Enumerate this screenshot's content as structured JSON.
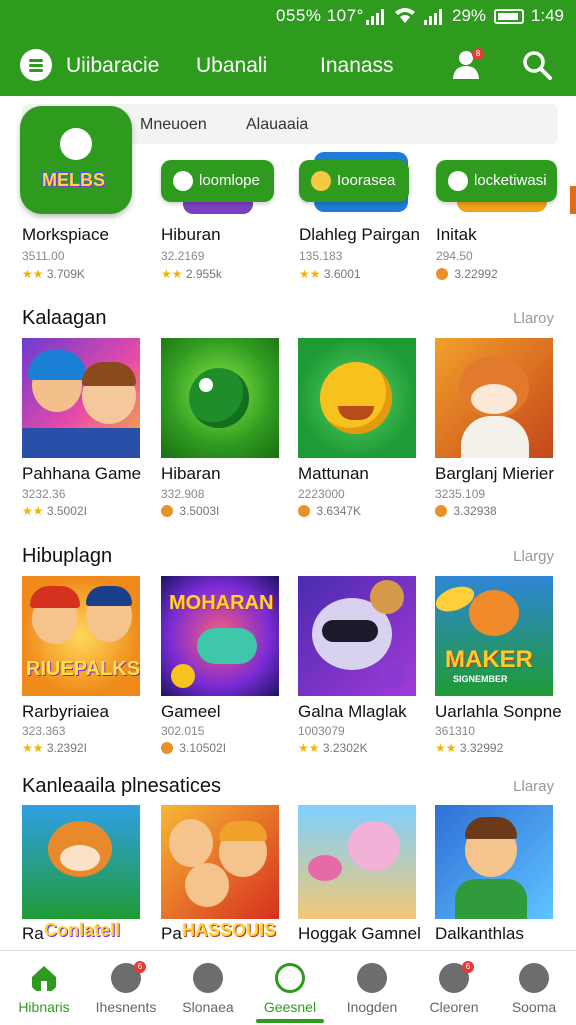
{
  "status_bar": {
    "left_text": "055% 107°",
    "battery_text": "29%",
    "time": "1:49"
  },
  "header": {
    "tabs": [
      "Uiibaracie",
      "Ubanali",
      "Inanass"
    ],
    "user_badge": "8",
    "colors": {
      "brand": "#2e9b1f",
      "header_bg": "#2e9b1f"
    }
  },
  "subtabs": [
    "Mneuoen",
    "Alauaaia"
  ],
  "featured": {
    "app_logo_text": "MELBS",
    "pills": [
      "loomlope",
      "Ioorasea",
      "locketiwasi"
    ],
    "cards": [
      {
        "title": "Morkspiace",
        "sub": "3511.00",
        "rating": "3.709K",
        "rating_icon": "star"
      },
      {
        "title": "Hiburan",
        "sub": "32.2169",
        "rating": "2.955k",
        "rating_icon": "star"
      },
      {
        "title": "Dlahleg Pairgan",
        "sub": "135.183",
        "rating": "3.6001",
        "rating_icon": "star"
      },
      {
        "title": "Initak",
        "sub": "294.50",
        "rating": "3.22992",
        "rating_icon": "coin"
      }
    ]
  },
  "sections": [
    {
      "title": "Kalaagan",
      "more": "Llaroy",
      "cards": [
        {
          "title": "Pahhana Game",
          "sub": "3232.36",
          "rating": "3.5002I",
          "rating_icon": "star"
        },
        {
          "title": "Hibaran",
          "sub": "332.908",
          "rating": "3.5003I",
          "rating_icon": "coin"
        },
        {
          "title": "Mattunan",
          "sub": "2223000",
          "rating": "3.6347K",
          "rating_icon": "coin"
        },
        {
          "title": "Barglanj Mierier",
          "sub": "3235.109",
          "rating": "3.32938",
          "rating_icon": "coin"
        }
      ]
    },
    {
      "title": "Hibuplagn",
      "more": "Llargy",
      "cards": [
        {
          "title": "Rarbyriaiea",
          "sub": "323.363",
          "rating": "3.2392I",
          "rating_icon": "star"
        },
        {
          "title": "Gameel",
          "sub": "302.015",
          "rating": "3.10502I",
          "rating_icon": "coin"
        },
        {
          "title": "Galna Mlaglak",
          "sub": "1003079",
          "rating": "3.2302K",
          "rating_icon": "star"
        },
        {
          "title": "Uarlahla Sonpne",
          "sub": "361310",
          "rating": "3.32992",
          "rating_icon": "star"
        }
      ]
    },
    {
      "title": "Kanleaaila plnesatices",
      "more": "Llaray",
      "cards": [
        {
          "title": "Ra",
          "overlay": "Conlatell"
        },
        {
          "title": "Pa",
          "overlay": "HASSOUIS"
        },
        {
          "title": "Hoggak Gamnel"
        },
        {
          "title": "Dalkanthlas"
        }
      ]
    }
  ],
  "thumb_art": {
    "featured_overlays": [
      "RIUEPALKS",
      "MOHARAN",
      "",
      "MAKER"
    ],
    "featured_overlay_sub": [
      "",
      "",
      "",
      "SIGNEMBER"
    ]
  },
  "bottom_nav": {
    "items": [
      {
        "label": "Hibnaris",
        "active": false,
        "badge": ""
      },
      {
        "label": "Ihesnents",
        "active": false,
        "badge": "6"
      },
      {
        "label": "Slonaea",
        "active": false,
        "badge": ""
      },
      {
        "label": "Geesnel",
        "active": true,
        "badge": ""
      },
      {
        "label": "Inogden",
        "active": false,
        "badge": ""
      },
      {
        "label": "Cleoren",
        "active": false,
        "badge": "6"
      },
      {
        "label": "Sooma",
        "active": false,
        "badge": ""
      }
    ]
  }
}
